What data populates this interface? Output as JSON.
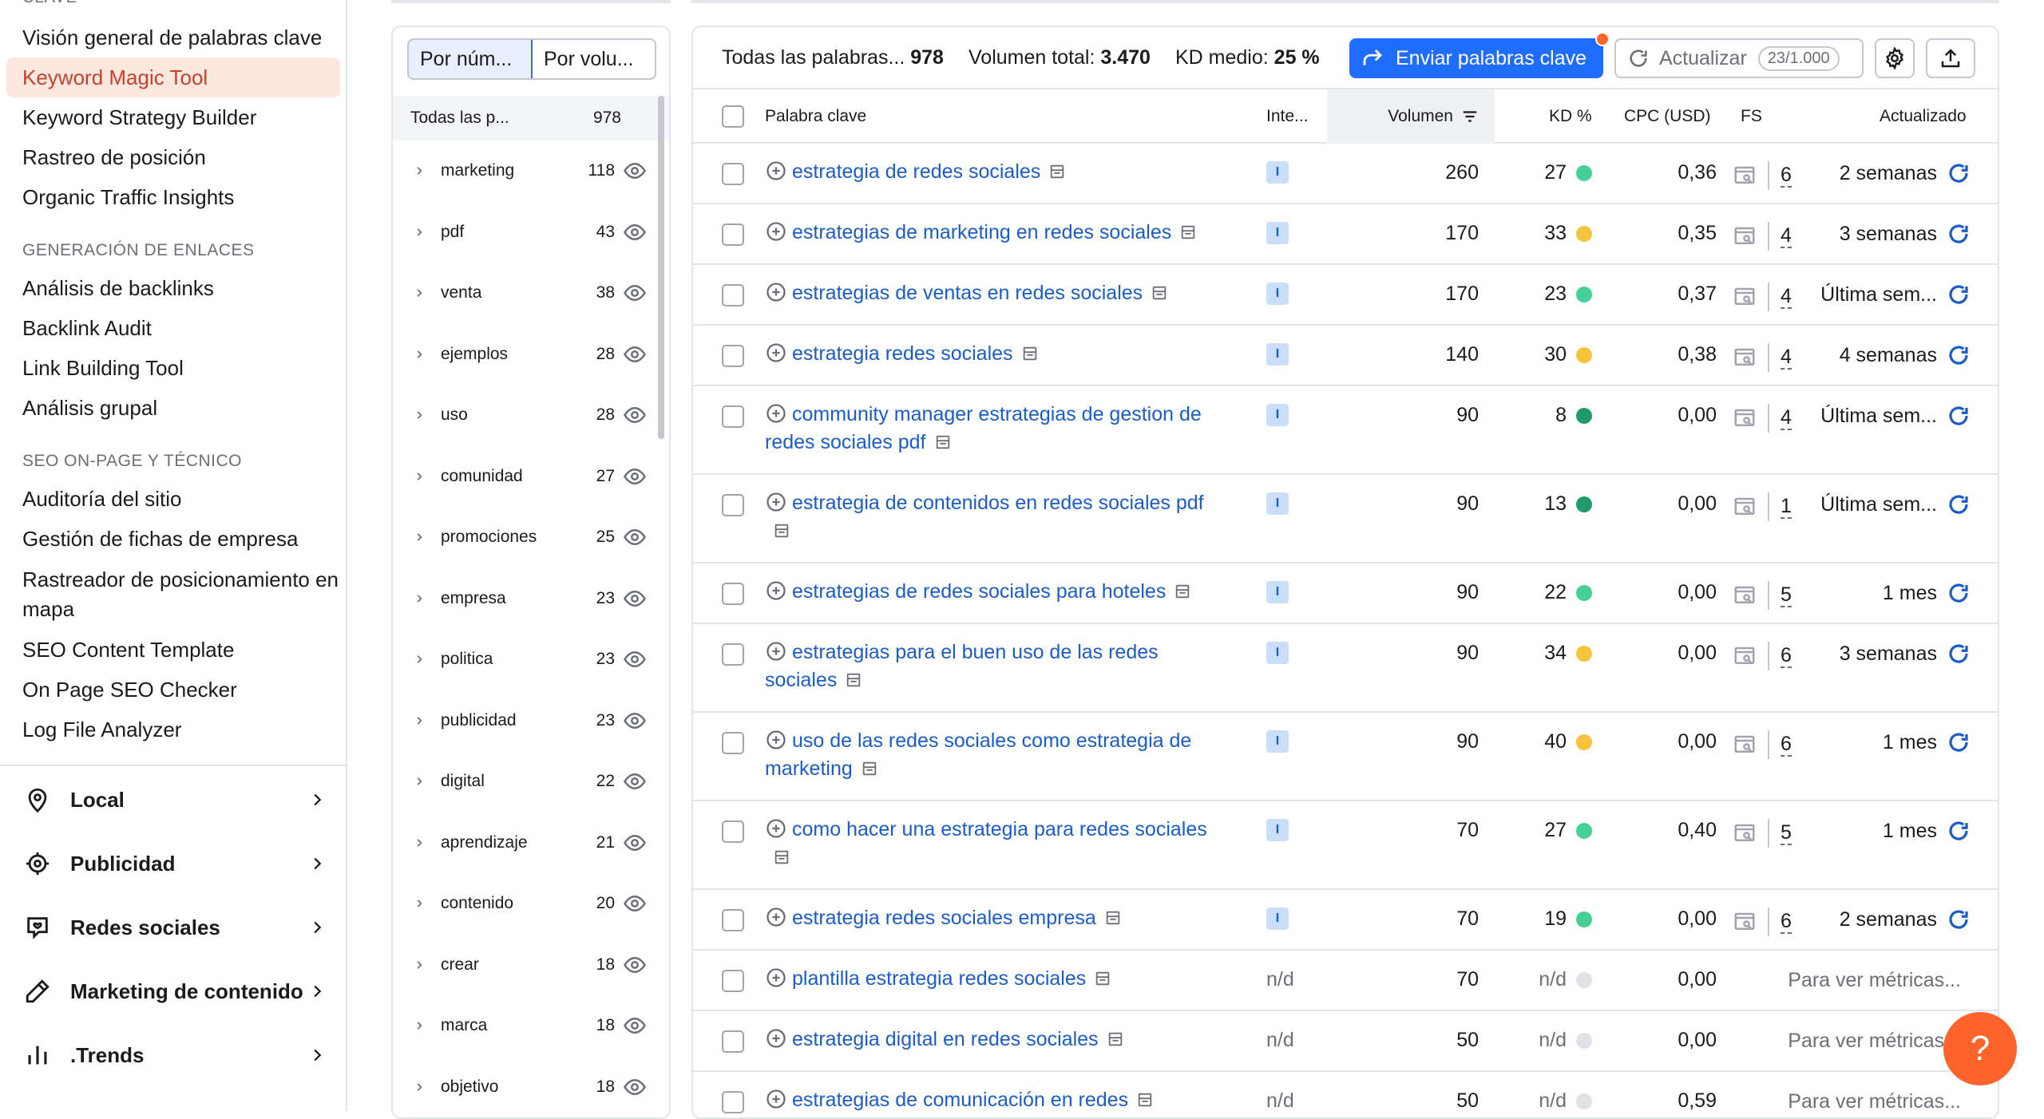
{
  "sidebar": {
    "cut_heading": "CLAVE",
    "links_top": [
      {
        "label": "Visión general de palabras clave",
        "active": false
      },
      {
        "label": "Keyword Magic Tool",
        "active": true
      },
      {
        "label": "Keyword Strategy Builder",
        "active": false
      },
      {
        "label": "Rastreo de posición",
        "active": false
      },
      {
        "label": "Organic Traffic Insights",
        "active": false
      }
    ],
    "section_links": "GENERACIÓN DE ENLACES",
    "links_links": [
      "Análisis de backlinks",
      "Backlink Audit",
      "Link Building Tool",
      "Análisis grupal"
    ],
    "section_onpage": "SEO ON-PAGE Y TÉCNICO",
    "links_onpage": [
      "Auditoría del sitio",
      "Gestión de fichas de empresa",
      "Rastreador de posicionamiento en mapa",
      "SEO Content Template",
      "On Page SEO Checker",
      "Log File Analyzer"
    ],
    "categories": [
      {
        "label": "Local",
        "icon": "location-pin-icon"
      },
      {
        "label": "Publicidad",
        "icon": "crosshair-icon"
      },
      {
        "label": "Redes sociales",
        "icon": "social-chat-icon"
      },
      {
        "label": "Marketing de contenido",
        "icon": "pencil-icon"
      },
      {
        "label": ".Trends",
        "icon": "bar-chart-icon"
      }
    ]
  },
  "groups": {
    "toggle": [
      "Por núm...",
      "Por volu..."
    ],
    "header_label": "Todas las p...",
    "header_count": "978",
    "items": [
      {
        "name": "marketing",
        "count": "118"
      },
      {
        "name": "pdf",
        "count": "43"
      },
      {
        "name": "venta",
        "count": "38"
      },
      {
        "name": "ejemplos",
        "count": "28"
      },
      {
        "name": "uso",
        "count": "28"
      },
      {
        "name": "comunidad",
        "count": "27"
      },
      {
        "name": "promociones",
        "count": "25"
      },
      {
        "name": "empresa",
        "count": "23"
      },
      {
        "name": "politica",
        "count": "23"
      },
      {
        "name": "publicidad",
        "count": "23"
      },
      {
        "name": "digital",
        "count": "22"
      },
      {
        "name": "aprendizaje",
        "count": "21"
      },
      {
        "name": "contenido",
        "count": "20"
      },
      {
        "name": "crear",
        "count": "18"
      },
      {
        "name": "marca",
        "count": "18"
      },
      {
        "name": "objetivo",
        "count": "18"
      }
    ]
  },
  "summary": {
    "all_label": "Todas las palabras...",
    "all_value": "978",
    "volume_label": "Volumen total:",
    "volume_value": "3.470",
    "kd_label": "KD medio:",
    "kd_value": "25 %"
  },
  "toolbar": {
    "send_label": "Enviar palabras clave",
    "refresh_label": "Actualizar",
    "refresh_quota": "23/1.000"
  },
  "table": {
    "columns": {
      "keyword": "Palabra clave",
      "intent": "Inte...",
      "volume": "Volumen",
      "kd": "KD %",
      "cpc": "CPC (USD)",
      "fs": "FS",
      "updated": "Actualizado"
    },
    "rows": [
      {
        "kw": "estrategia de redes sociales",
        "intent": "I",
        "vol": "260",
        "kd": "27",
        "kd_color": "#45d196",
        "cpc": "0,36",
        "fs": "6",
        "upd": "2 semanas"
      },
      {
        "kw": "estrategias de marketing en redes sociales",
        "intent": "I",
        "vol": "170",
        "kd": "33",
        "kd_color": "#f5c43d",
        "cpc": "0,35",
        "fs": "4",
        "upd": "3 semanas"
      },
      {
        "kw": "estrategias de ventas en redes sociales",
        "intent": "I",
        "vol": "170",
        "kd": "23",
        "kd_color": "#45d196",
        "cpc": "0,37",
        "fs": "4",
        "upd": "Última sem..."
      },
      {
        "kw": "estrategia redes sociales",
        "intent": "I",
        "vol": "140",
        "kd": "30",
        "kd_color": "#f5c43d",
        "cpc": "0,38",
        "fs": "4",
        "upd": "4 semanas"
      },
      {
        "kw": "community manager estrategias de gestion de redes sociales pdf",
        "intent": "I",
        "vol": "90",
        "kd": "8",
        "kd_color": "#1f9b6a",
        "cpc": "0,00",
        "fs": "4",
        "upd": "Última sem..."
      },
      {
        "kw": "estrategia de contenidos en redes sociales pdf",
        "intent": "I",
        "vol": "90",
        "kd": "13",
        "kd_color": "#1f9b6a",
        "cpc": "0,00",
        "fs": "1",
        "upd": "Última sem..."
      },
      {
        "kw": "estrategias de redes sociales para hoteles",
        "intent": "I",
        "vol": "90",
        "kd": "22",
        "kd_color": "#45d196",
        "cpc": "0,00",
        "fs": "5",
        "upd": "1 mes"
      },
      {
        "kw": "estrategias para el buen uso de las redes sociales",
        "intent": "I",
        "vol": "90",
        "kd": "34",
        "kd_color": "#f5c43d",
        "cpc": "0,00",
        "fs": "6",
        "upd": "3 semanas"
      },
      {
        "kw": "uso de las redes sociales como estrategia de marketing",
        "intent": "I",
        "vol": "90",
        "kd": "40",
        "kd_color": "#f5c43d",
        "cpc": "0,00",
        "fs": "6",
        "upd": "1 mes"
      },
      {
        "kw": "como hacer una estrategia para redes sociales",
        "intent": "I",
        "vol": "70",
        "kd": "27",
        "kd_color": "#45d196",
        "cpc": "0,40",
        "fs": "5",
        "upd": "1 mes"
      },
      {
        "kw": "estrategia redes sociales empresa",
        "intent": "I",
        "vol": "70",
        "kd": "19",
        "kd_color": "#45d196",
        "cpc": "0,00",
        "fs": "6",
        "upd": "2 semanas"
      },
      {
        "kw": "plantilla estrategia redes sociales",
        "intent": "n/d",
        "vol": "70",
        "kd": "n/d",
        "kd_color": "#e0e2e6",
        "cpc": "0,00",
        "fs": "",
        "upd": "Para ver métricas..."
      },
      {
        "kw": "estrategia digital en redes sociales",
        "intent": "n/d",
        "vol": "50",
        "kd": "n/d",
        "kd_color": "#e0e2e6",
        "cpc": "0,00",
        "fs": "",
        "upd": "Para ver métricas..."
      },
      {
        "kw": "estrategias de comunicación en redes",
        "intent": "n/d",
        "vol": "50",
        "kd": "n/d",
        "kd_color": "#e0e2e6",
        "cpc": "0,59",
        "fs": "",
        "upd": "Para ver métricas..."
      }
    ]
  },
  "help_label": "?"
}
